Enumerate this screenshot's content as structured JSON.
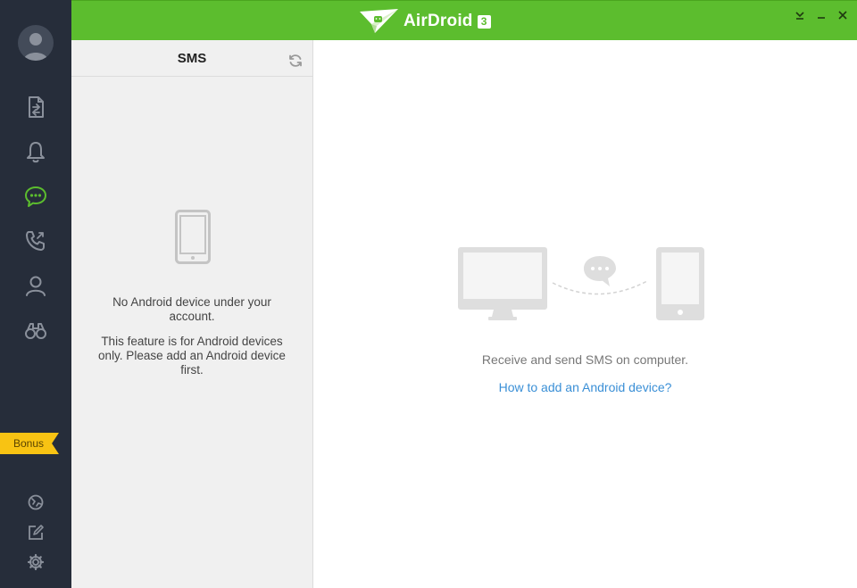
{
  "app": {
    "name": "AirDroid",
    "version_badge": "3",
    "brand_color": "#5cbd2e",
    "sidebar_color": "#262d3a"
  },
  "sidebar": {
    "items": [
      {
        "icon": "file-transfer-icon",
        "active": false
      },
      {
        "icon": "notification-bell-icon",
        "active": false
      },
      {
        "icon": "sms-chat-icon",
        "active": true
      },
      {
        "icon": "call-log-icon",
        "active": false
      },
      {
        "icon": "contacts-icon",
        "active": false
      },
      {
        "icon": "binoculars-icon",
        "active": false
      }
    ],
    "bonus_label": "Bonus",
    "bottom_items": [
      {
        "icon": "web-icon"
      },
      {
        "icon": "feedback-edit-icon"
      },
      {
        "icon": "settings-gear-icon"
      }
    ]
  },
  "window_controls": [
    "minimize-to-tray-icon",
    "minimize-icon",
    "close-icon"
  ],
  "panel": {
    "title": "SMS",
    "message_primary": "No Android device under your account.",
    "message_secondary": "This feature is for Android devices only. Please add an Android device first."
  },
  "main": {
    "description": "Receive and send SMS on computer.",
    "link_text": "How to add an Android device?",
    "link_color": "#3a8fd6"
  }
}
